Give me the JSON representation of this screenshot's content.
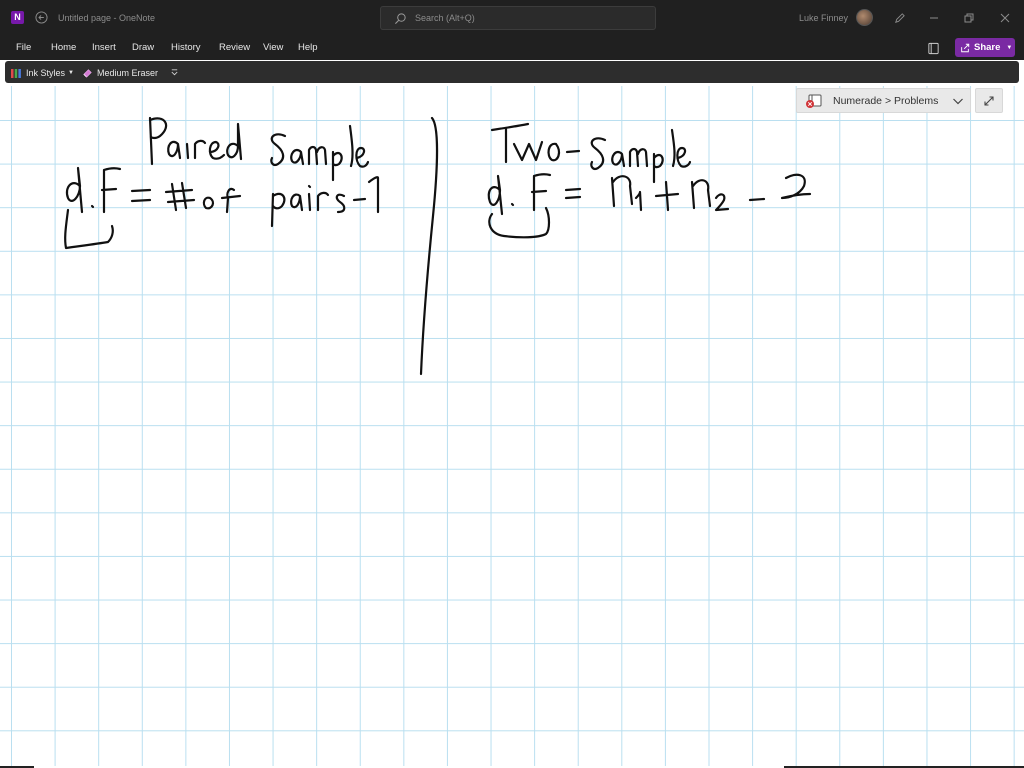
{
  "titlebar": {
    "app_icon_letter": "N",
    "app_icon": "onenote-icon",
    "back_icon": "back-arrow-icon",
    "title": "Untitled page - OneNote",
    "search_placeholder": "Search (Alt+Q)",
    "search_icon": "search-icon",
    "user_name": "Luke Finney",
    "pen_icon": "pen-icon",
    "window_controls": [
      "minimize-icon",
      "restore-icon",
      "close-icon"
    ]
  },
  "menubar": {
    "items": [
      "File",
      "Home",
      "Insert",
      "Draw",
      "History",
      "Review",
      "View",
      "Help"
    ],
    "notebook_icon": "notebook-icon",
    "share_label": "Share",
    "share_icon": "share-icon"
  },
  "ribbon": {
    "ink_styles_label": "Ink Styles",
    "eraser_label": "Medium Eraser",
    "overflow_icon": "more-options-icon"
  },
  "canvas": {
    "notebook_path": "Numerade > Problems",
    "sync_error_icon": "notebook-sync-error-icon",
    "expand_icon": "expand-icon"
  },
  "colors": {
    "titlebar_bg": "#202020",
    "ribbon_bg": "#2d2d2d",
    "accent": "#7a2aa3",
    "grid_line": "#b9dff0",
    "ink": "#111111"
  }
}
